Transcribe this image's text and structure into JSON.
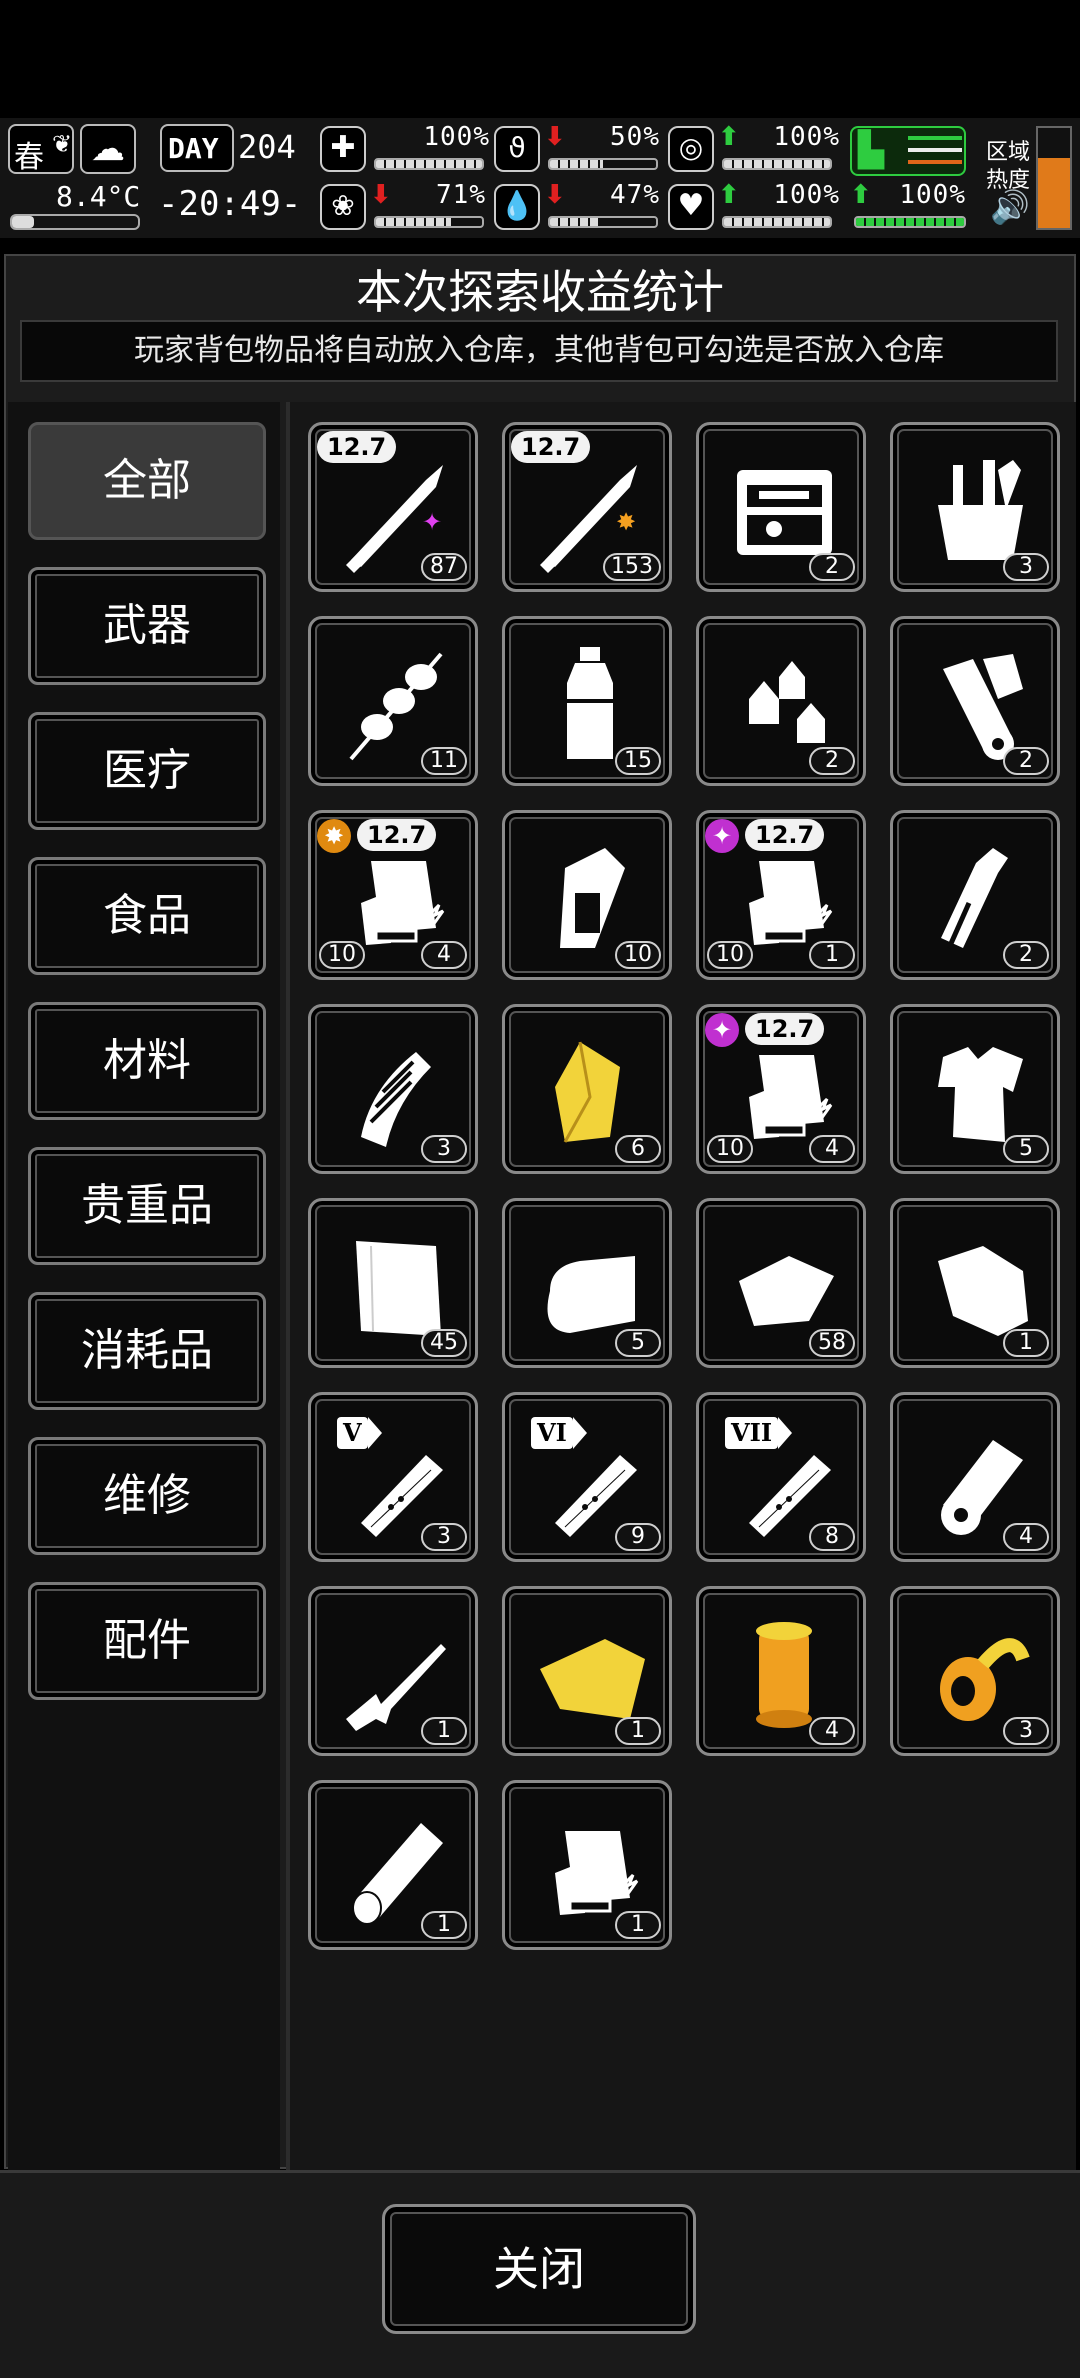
{
  "status": {
    "season": "春",
    "temperature": "8.4°C",
    "day_label": "DAY",
    "day_number": "204",
    "clock": "-20:49-",
    "stats": {
      "health": "100%",
      "hunger": "50%",
      "stamina": "100%",
      "mental": "71%",
      "thirst": "47%",
      "heart": "100%",
      "speed": "100%"
    },
    "region_heat_label_1": "区域",
    "region_heat_label_2": "热度"
  },
  "panel": {
    "title": "本次探索收益统计",
    "notice": "玩家背包物品将自动放入仓库，其他背包可勾选是否放入仓库",
    "close_label": "关闭"
  },
  "categories": [
    {
      "label": "全部",
      "active": true
    },
    {
      "label": "武器"
    },
    {
      "label": "医疗"
    },
    {
      "label": "食品"
    },
    {
      "label": "材料"
    },
    {
      "label": "贵重品"
    },
    {
      "label": "消耗品"
    },
    {
      "label": "维修"
    },
    {
      "label": "配件"
    }
  ],
  "items": [
    {
      "icon": "bullet-icon",
      "count": "87",
      "caliber": "12.7",
      "badge": "pink"
    },
    {
      "icon": "bullet-icon",
      "count": "153",
      "caliber": "12.7",
      "badge": "orange"
    },
    {
      "icon": "toolkit-icon",
      "count": "2"
    },
    {
      "icon": "tool-bag-icon",
      "count": "3"
    },
    {
      "icon": "meat-skewer-icon",
      "count": "11"
    },
    {
      "icon": "water-bottle-icon",
      "count": "15"
    },
    {
      "icon": "lanterns-icon",
      "count": "2"
    },
    {
      "icon": "scrolls-icon",
      "count": "2"
    },
    {
      "icon": "ammo-box-icon",
      "count": "4",
      "count_left": "10",
      "caliber": "12.7",
      "badge": "orange"
    },
    {
      "icon": "flask-icon",
      "count": "10"
    },
    {
      "icon": "ammo-box-icon",
      "count": "1",
      "count_left": "10",
      "caliber": "12.7",
      "badge": "pink"
    },
    {
      "icon": "bottle-icon",
      "count": "2"
    },
    {
      "icon": "magazine-icon",
      "count": "3"
    },
    {
      "icon": "gold-ore-icon",
      "count": "6"
    },
    {
      "icon": "ammo-box-icon",
      "count": "4",
      "count_left": "10",
      "caliber": "12.7",
      "badge": "pink"
    },
    {
      "icon": "torn-shirt-icon",
      "count": "5"
    },
    {
      "icon": "cloth-icon",
      "count": "45"
    },
    {
      "icon": "towel-icon",
      "count": "5"
    },
    {
      "icon": "rag-icon",
      "count": "58"
    },
    {
      "icon": "leather-icon",
      "count": "1"
    },
    {
      "icon": "test-tube-icon",
      "count": "3",
      "roman": "V"
    },
    {
      "icon": "test-tube-icon",
      "count": "9",
      "roman": "VI"
    },
    {
      "icon": "test-tube-icon",
      "count": "8",
      "roman": "VII"
    },
    {
      "icon": "paper-roll-icon",
      "count": "4"
    },
    {
      "icon": "rifle-icon",
      "count": "1"
    },
    {
      "icon": "gold-cloth-icon",
      "count": "1"
    },
    {
      "icon": "gold-spool-icon",
      "count": "4"
    },
    {
      "icon": "gold-pipe-icon",
      "count": "3"
    },
    {
      "icon": "log-icon",
      "count": "1"
    },
    {
      "icon": "ammo-box-icon",
      "count": "1"
    }
  ]
}
